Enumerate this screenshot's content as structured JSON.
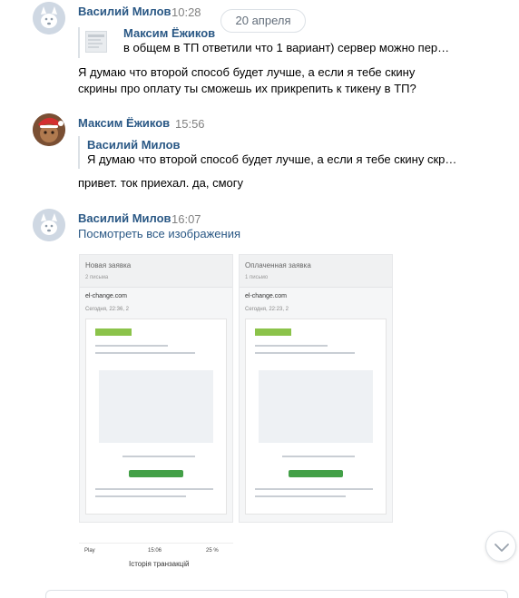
{
  "date_pill": "20 апреля",
  "messages": [
    {
      "author": "Василий Милов",
      "time": "10:28",
      "reply": {
        "author": "Максим Ёжиков",
        "text": "в общем в ТП ответили что 1 вариант) сервер можно пер…"
      },
      "lines": [
        "Я думаю что второй способ будет лучше, а если я тебе скину",
        "скрины про оплату ты сможешь их прикрепить к тикену в ТП?"
      ]
    },
    {
      "author": "Максим Ёжиков",
      "time": "15:56",
      "reply": {
        "author": "Василий Милов",
        "text": "Я думаю что второй способ будет лучше, а если я тебе скину скр…"
      },
      "lines": [
        "привет. ток приехал. да, смогу"
      ]
    },
    {
      "author": "Василий Милов",
      "time": "16:07",
      "view_all": "Посмотреть все изображения",
      "images": [
        {
          "title": "Новая заявка",
          "subtitle": "2 письма",
          "sender": "el-change.com",
          "date": "Сегодня, 22:36, 2"
        },
        {
          "title": "Оплаченная заявка",
          "subtitle": "1 письмо",
          "sender": "el-change.com",
          "date": "Сегодня, 22:23, 2"
        }
      ],
      "phone_image": {
        "carrier": "Play",
        "clock": "15:06",
        "battery": "25 %",
        "title": "Історія транзакцій"
      }
    }
  ],
  "icons": {
    "scroll_down": "chevron-down-icon"
  }
}
